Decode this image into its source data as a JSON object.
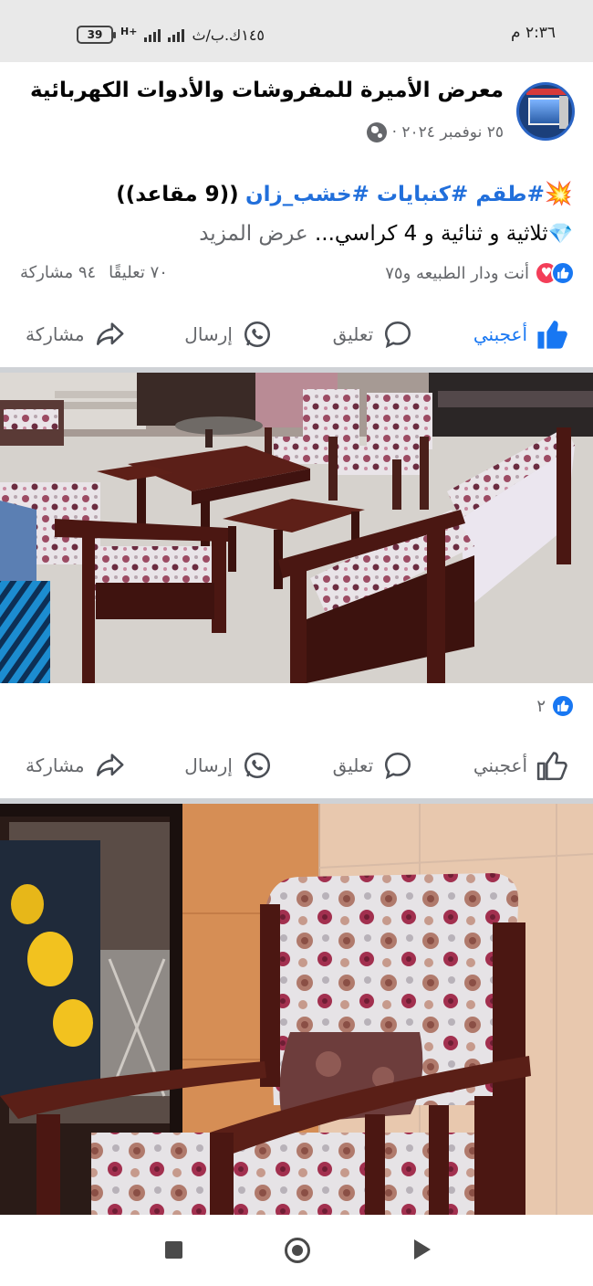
{
  "status_bar": {
    "time": "٢:٣٦ م",
    "speed": "١٤٥ك.ب/ث",
    "network": "H+",
    "battery": "39"
  },
  "post": {
    "page_name": "معرض الأميرة للمفروشات والأدوات الكهربائية",
    "date": "٢٥ نوفمبر ٢٠٢٤ ·",
    "text_emoji_1": "💥",
    "hashtags": "#طقم #كنبايات #خشب_زان",
    "text_title_rest": "((9 مقاعد))",
    "text_emoji_2": "💎",
    "text_line2": "ثلاثية و ثنائية و 4 كراسي... ",
    "see_more": "عرض المزيد",
    "reactors": "أنت ودار الطبيعه و٧٥",
    "comments_count": "٧٠ تعليقًا",
    "shares_count": "٩٤ مشاركة"
  },
  "actions": {
    "like": "أعجبني",
    "comment": "تعليق",
    "send": "إرسال",
    "share": "مشاركة"
  },
  "photo1": {
    "likes": "٢"
  },
  "colors": {
    "facebook_blue": "#1877f2",
    "love_red": "#f33e58",
    "gray_text": "#65676b"
  }
}
